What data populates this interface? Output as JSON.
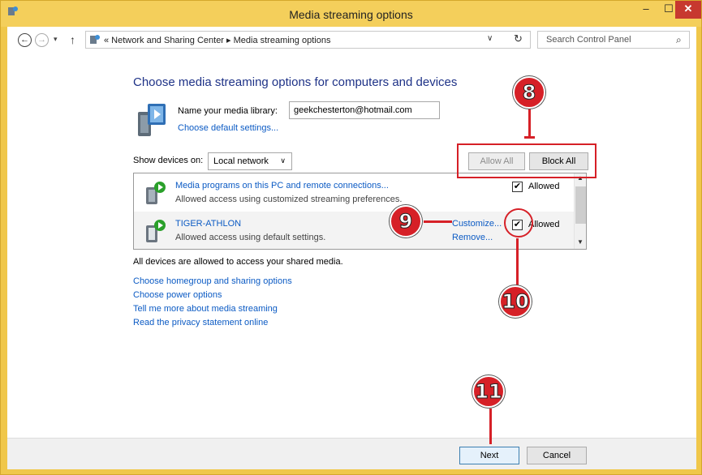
{
  "window": {
    "title": "Media streaming options",
    "min_glyph": "‒",
    "max_glyph": "☐",
    "close_glyph": "✕"
  },
  "address_bar": {
    "back_glyph": "←",
    "forward_glyph": "→",
    "recent_glyph": "▾",
    "up_glyph": "↑",
    "path_text": "« Network and Sharing Center ▸ Media streaming options",
    "dropdown_glyph": "∨",
    "refresh_glyph": "↻",
    "search_placeholder": "Search Control Panel",
    "search_glyph": "⌕"
  },
  "main": {
    "heading": "Choose media streaming options for computers and devices",
    "library_label": "Name your media library:",
    "library_value": "geekchesterton@hotmail.com",
    "default_settings_link": "Choose default settings...",
    "show_devices_label": "Show devices on:",
    "show_devices_value": "Local network",
    "dropdown_glyph": "∨",
    "allow_all": "Allow All",
    "block_all": "Block All",
    "devices": [
      {
        "name": "Media programs on this PC and remote connections...",
        "status": "Allowed access using customized streaming preferences.",
        "allowed_label": "Allowed",
        "checked": true
      },
      {
        "name": "TIGER-ATHLON",
        "status": "Allowed access using default settings.",
        "allowed_label": "Allowed",
        "checked": true,
        "customize": "Customize...",
        "remove": "Remove..."
      }
    ],
    "check_glyph": "✔",
    "scroll_up_glyph": "▲",
    "scroll_down_glyph": "▼",
    "all_allowed_text": "All devices are allowed to access your shared media.",
    "links": [
      "Choose homegroup and sharing options",
      "Choose power options",
      "Tell me more about media streaming",
      "Read the privacy statement online"
    ]
  },
  "footer": {
    "next": "Next",
    "cancel": "Cancel"
  },
  "callouts": [
    "8",
    "9",
    "10",
    "11"
  ],
  "colors": {
    "accent_red": "#d62027",
    "link_blue": "#0c5bc4",
    "heading_blue": "#1e3287",
    "titlebar": "#f4cf5b"
  },
  "icons": [
    "media-library-icon",
    "control-panel-icon",
    "device-icon",
    "play-overlay-icon"
  ]
}
